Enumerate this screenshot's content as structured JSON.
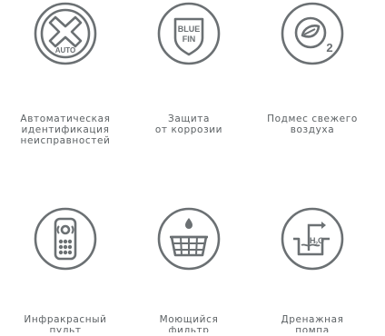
{
  "colors": {
    "icon_stroke": "#6b7073",
    "text": "#5c6164"
  },
  "features": [
    {
      "icon": "auto-diagnosis-icon",
      "icon_text": "AUTO",
      "lines": [
        "Автоматическая",
        "идентификация",
        "неисправностей"
      ]
    },
    {
      "icon": "blue-fin-shield-icon",
      "icon_text_1": "BLUE",
      "icon_text_2": "FIN",
      "lines": [
        "Защита",
        "от коррозии"
      ]
    },
    {
      "icon": "fresh-air-leaf-icon",
      "icon_text": "2",
      "lines": [
        "Подмес свежего",
        "воздуха"
      ]
    },
    {
      "icon": "ir-remote-icon",
      "lines": [
        "Инфракрасный",
        "пульт"
      ]
    },
    {
      "icon": "washable-filter-icon",
      "lines": [
        "Моющийся",
        "фильтр"
      ]
    },
    {
      "icon": "drain-pump-icon",
      "icon_text_1": "H",
      "icon_text_2": "2",
      "icon_text_3": "O",
      "lines": [
        "Дренажная",
        "помпа"
      ]
    }
  ]
}
